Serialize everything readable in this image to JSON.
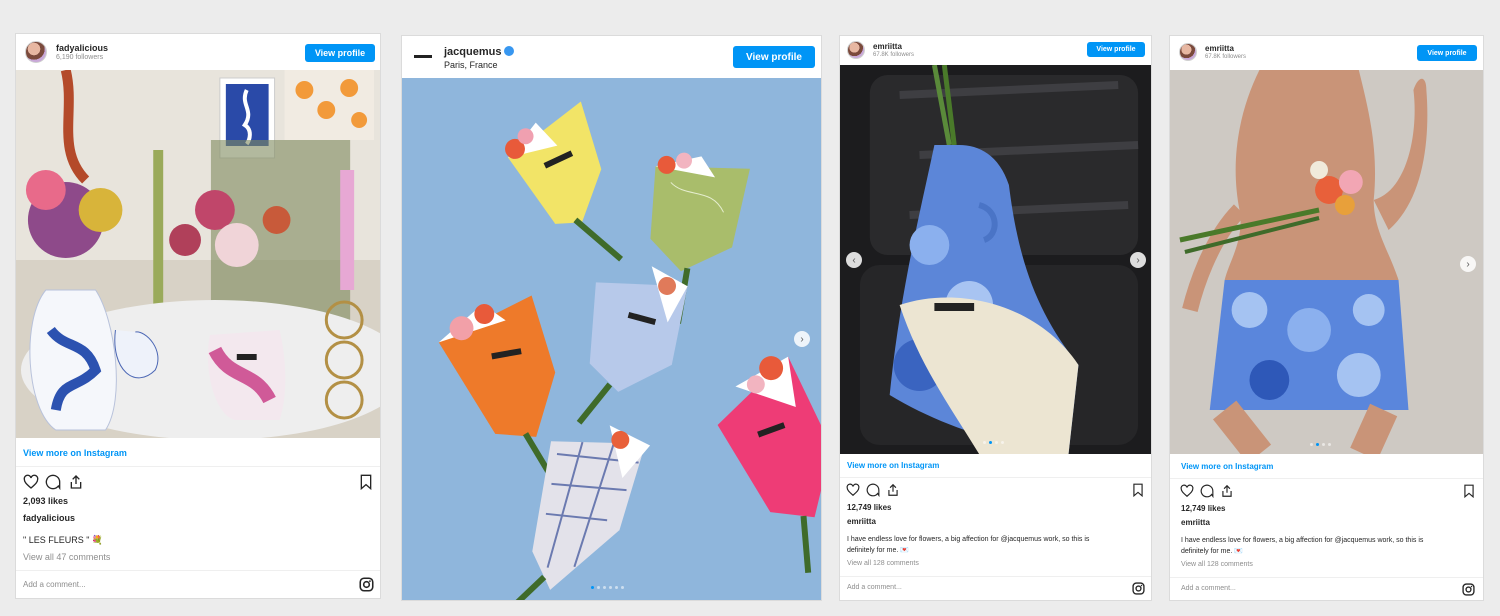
{
  "posts": [
    {
      "username": "fadyalicious",
      "followers": "6,190 followers",
      "view_profile": "View profile",
      "view_more": "View more on Instagram",
      "likes": "2,093 likes",
      "caption_user": "fadyalicious",
      "caption": "\" LES FLEURS \" 💐",
      "comments": "View all 47 comments",
      "add_comment": "Add a comment..."
    },
    {
      "username": "jacquemus",
      "location": "Paris, France",
      "view_profile": "View profile"
    },
    {
      "username": "emriitta",
      "followers": "67.8K followers",
      "view_profile": "View profile",
      "view_more": "View more on Instagram",
      "likes": "12,749 likes",
      "caption_user": "emriitta",
      "caption_line1": "I have endless love for flowers, a big affection for @jacquemus work, so this is",
      "caption_line2": "definitely for me. 💌",
      "comments": "View all 128 comments",
      "add_comment": "Add a comment..."
    },
    {
      "username": "emriitta",
      "followers": "67.8K followers",
      "view_profile": "View profile",
      "view_more": "View more on Instagram",
      "likes": "12,749 likes",
      "caption_user": "emriitta",
      "caption_line1": "I have endless love for flowers, a big affection for @jacquemus work, so this is",
      "caption_line2": "definitely for me. 💌",
      "comments": "View all 128 comments",
      "add_comment": "Add a comment..."
    }
  ],
  "icons": [
    "heart-icon",
    "comment-icon",
    "share-icon",
    "bookmark-icon",
    "instagram-icon",
    "chevron-right-icon",
    "chevron-left-icon",
    "verified-icon"
  ],
  "colors": {
    "accent": "#0095f6",
    "background": "#ececec",
    "text": "#262626",
    "muted": "#8e8e8e"
  }
}
